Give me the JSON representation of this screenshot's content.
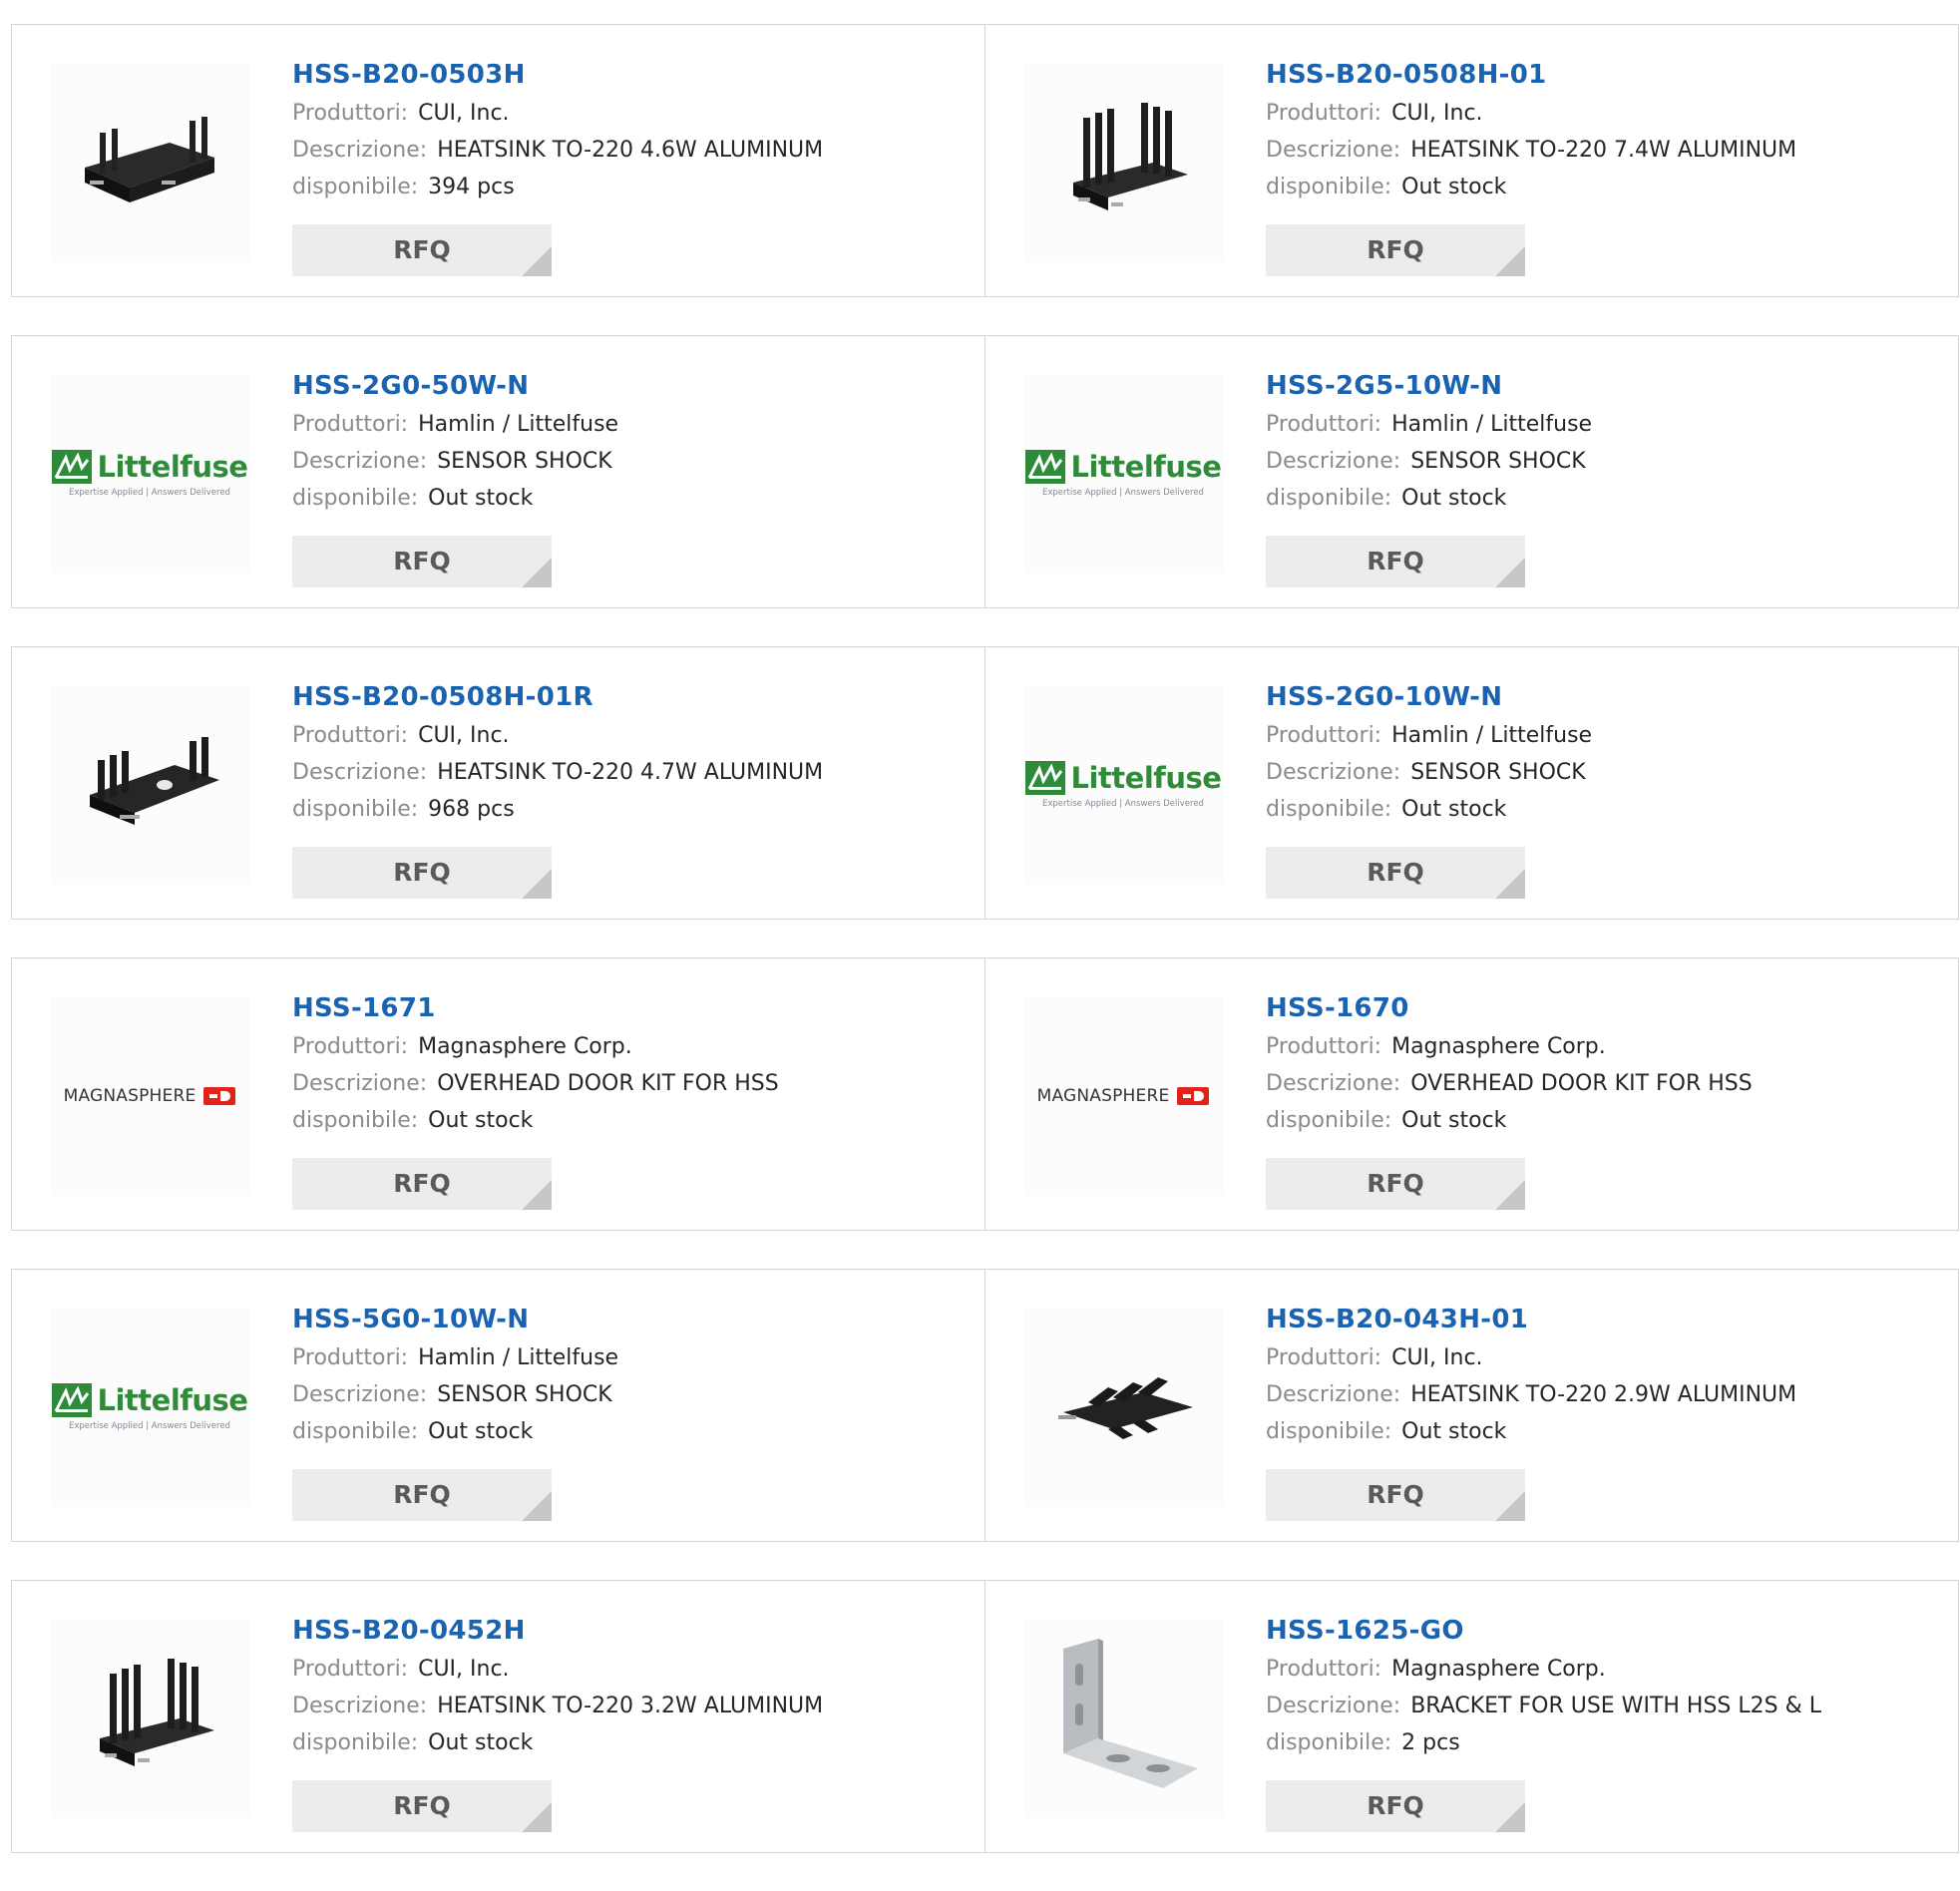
{
  "labels": {
    "manufacturer": "Produttori:",
    "description": "Descrizione:",
    "availability": "disponibile:",
    "rfq": "RFQ"
  },
  "colors": {
    "link": "#1a63b0",
    "littelfuse_green": "#2e8b3a",
    "magnasphere_red": "#e2231a"
  },
  "products": [
    {
      "part": "HSS-B20-0503H",
      "manufacturer": "CUI, Inc.",
      "description": "HEATSINK TO-220 4.6W ALUMINUM",
      "availability": "394 pcs",
      "image": "heatsink-u"
    },
    {
      "part": "HSS-B20-0508H-01",
      "manufacturer": "CUI, Inc.",
      "description": "HEATSINK TO-220 7.4W ALUMINUM",
      "availability": "Out stock",
      "image": "heatsink-tall"
    },
    {
      "part": "HSS-2G0-50W-N",
      "manufacturer": "Hamlin / Littelfuse",
      "description": "SENSOR SHOCK",
      "availability": "Out stock",
      "image": "littelfuse-logo"
    },
    {
      "part": "HSS-2G5-10W-N",
      "manufacturer": "Hamlin / Littelfuse",
      "description": "SENSOR SHOCK",
      "availability": "Out stock",
      "image": "littelfuse-logo"
    },
    {
      "part": "HSS-B20-0508H-01R",
      "manufacturer": "CUI, Inc.",
      "description": "HEATSINK TO-220 4.7W ALUMINUM",
      "availability": "968 pcs",
      "image": "heatsink-fin"
    },
    {
      "part": "HSS-2G0-10W-N",
      "manufacturer": "Hamlin / Littelfuse",
      "description": "SENSOR SHOCK",
      "availability": "Out stock",
      "image": "littelfuse-logo"
    },
    {
      "part": "HSS-1671",
      "manufacturer": "Magnasphere Corp.",
      "description": "OVERHEAD DOOR KIT FOR HSS",
      "availability": "Out stock",
      "image": "magnasphere-logo"
    },
    {
      "part": "HSS-1670",
      "manufacturer": "Magnasphere Corp.",
      "description": "OVERHEAD DOOR KIT FOR HSS",
      "availability": "Out stock",
      "image": "magnasphere-logo"
    },
    {
      "part": "HSS-5G0-10W-N",
      "manufacturer": "Hamlin / Littelfuse",
      "description": "SENSOR SHOCK",
      "availability": "Out stock",
      "image": "littelfuse-logo"
    },
    {
      "part": "HSS-B20-043H-01",
      "manufacturer": "CUI, Inc.",
      "description": "HEATSINK TO-220 2.9W ALUMINUM",
      "availability": "Out stock",
      "image": "heatsink-flat"
    },
    {
      "part": "HSS-B20-0452H",
      "manufacturer": "CUI, Inc.",
      "description": "HEATSINK TO-220 3.2W ALUMINUM",
      "availability": "Out stock",
      "image": "heatsink-tall"
    },
    {
      "part": "HSS-1625-GO",
      "manufacturer": "Magnasphere Corp.",
      "description": "BRACKET FOR USE WITH HSS L2S & L",
      "availability": "2 pcs",
      "image": "bracket"
    }
  ],
  "logos": {
    "littelfuse": {
      "word": "Littelfuse",
      "tagline": "Expertise Applied | Answers Delivered"
    },
    "magnasphere": {
      "word": "MAGNASPHERE"
    }
  }
}
